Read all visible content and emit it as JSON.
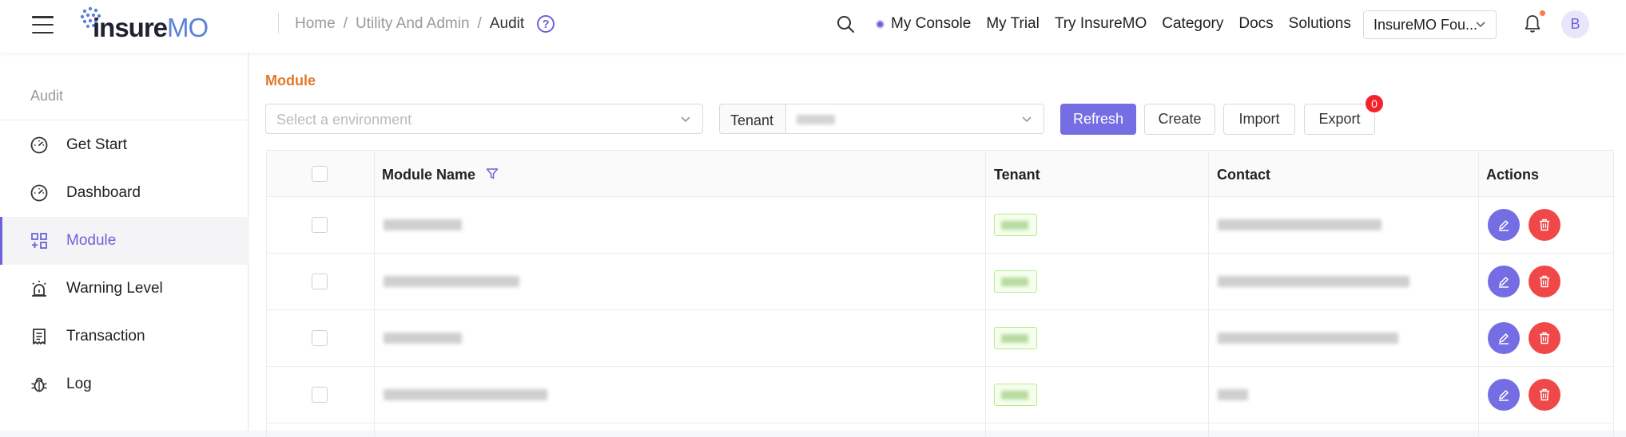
{
  "header": {
    "logo": {
      "part1": "insure",
      "part2": "MO"
    },
    "breadcrumb": [
      "Home",
      "Utility And Admin",
      "Audit"
    ],
    "breadcrumb_separator": "/",
    "help_glyph": "?",
    "nav": {
      "console": "My Console",
      "trial": "My Trial",
      "try": "Try InsureMO",
      "category": "Category",
      "docs": "Docs",
      "solutions": "Solutions"
    },
    "tenant_selector": "InsureMO Fou...",
    "avatar_initial": "B",
    "accent": "#6c63d8"
  },
  "sidebar": {
    "title": "Audit",
    "items": [
      {
        "label": "Get Start",
        "icon": "gauge-icon",
        "active": false
      },
      {
        "label": "Dashboard",
        "icon": "gauge-icon",
        "active": false
      },
      {
        "label": "Module",
        "icon": "module-grid-icon",
        "active": true
      },
      {
        "label": "Warning Level",
        "icon": "alarm-icon",
        "active": false
      },
      {
        "label": "Transaction",
        "icon": "receipt-icon",
        "active": false
      },
      {
        "label": "Log",
        "icon": "bug-icon",
        "active": false
      }
    ]
  },
  "main": {
    "section_title": "Module",
    "environment": {
      "placeholder": "Select a environment"
    },
    "tenant_label": "Tenant",
    "buttons": {
      "refresh": "Refresh",
      "create": "Create",
      "import": "Import",
      "export": "Export"
    },
    "export_badge": "0",
    "table": {
      "columns": [
        "Module Name",
        "Tenant",
        "Contact",
        "Actions"
      ],
      "row_count": 4
    }
  }
}
